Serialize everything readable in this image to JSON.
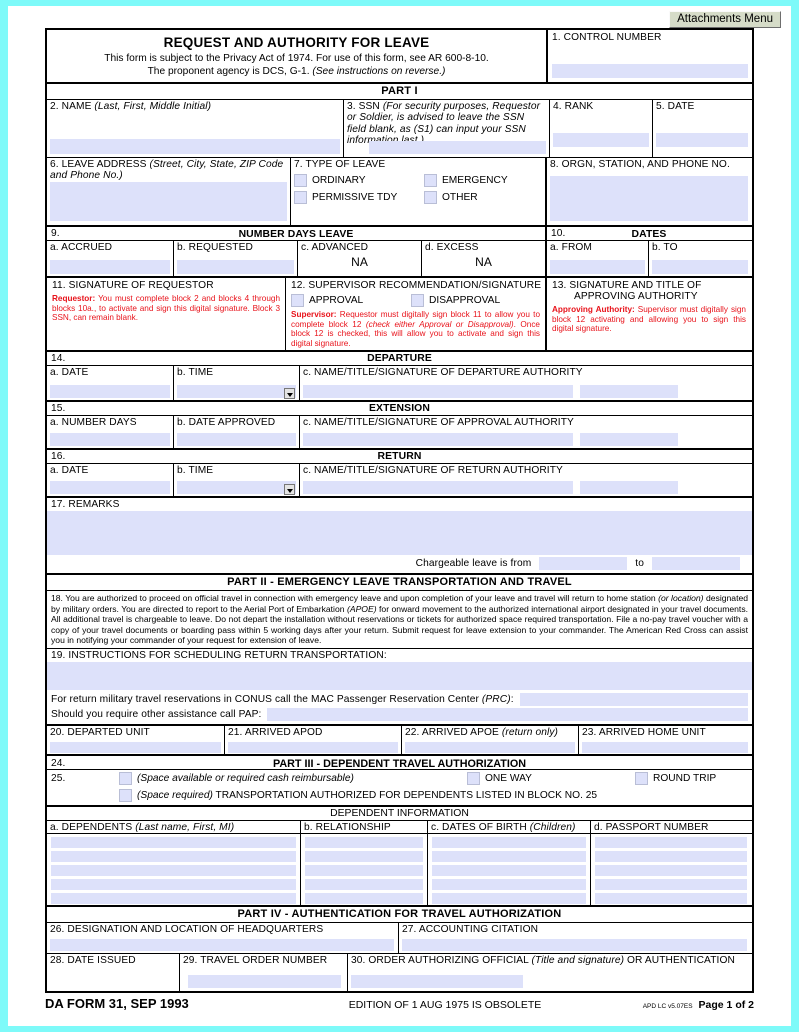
{
  "toolbar": {
    "attachments_label": "Attachments Menu"
  },
  "header": {
    "title": "REQUEST AND AUTHORITY FOR LEAVE",
    "sub1": "This form is subject to the Privacy Act of 1974. For use of this form, see AR 600-8-10.",
    "sub2_a": "The proponent agency is DCS, G-1. ",
    "sub2_b": "(See instructions on reverse.)",
    "block1_label": "1.  CONTROL NUMBER"
  },
  "part1": {
    "bar": "PART I",
    "name_label": "2.  NAME  ",
    "name_hint": "(Last, First, Middle Initial)",
    "ssn_label": "3.  SSN  ",
    "ssn_hint": "(For security purposes, Requestor or Soldier, is advised to leave the SSN field blank, as (S1) can input your SSN information last.)",
    "rank_label": "4.  RANK",
    "date_label": "5.  DATE",
    "address_label": "6.  LEAVE ADDRESS  ",
    "address_hint": "(Street, City, State, ZIP Code and Phone No.)",
    "type_label": "7.  TYPE OF LEAVE",
    "type_options": [
      "ORDINARY",
      "EMERGENCY",
      "PERMISSIVE TDY",
      "OTHER"
    ],
    "orgn_label": "8.  ORGN, STATION, AND PHONE NO.",
    "block9_num": "9.",
    "block9_title": "NUMBER DAYS LEAVE",
    "block10_num": "10.",
    "block10_title": "DATES",
    "days_cols": [
      "a.  ACCRUED",
      "b.  REQUESTED",
      "c.  ADVANCED",
      "d.  EXCESS"
    ],
    "advanced_value": "NA",
    "excess_value": "NA",
    "dates_cols": [
      "a.  FROM",
      "b.  TO"
    ],
    "block11_label": "11.  SIGNATURE OF REQUESTOR",
    "block11_red_bold": "Requestor:",
    "block11_red": " You must complete block 2 and blocks 4 through blocks 10a., to activate and sign this digital signature. Block 3 SSN, can remain blank.",
    "block12_label": "12.  SUPERVISOR RECOMMENDATION/SIGNATURE",
    "block12_options": [
      "APPROVAL",
      "DISAPPROVAL"
    ],
    "block12_red_bold": "Supervisor:",
    "block12_red_a": " Requestor must digitally sign block 11 to allow you to complete block 12 ",
    "block12_red_it": "(check either Approval or Disapproval)",
    "block12_red_b": ". Once block 12 is checked, this will allow you to activate and sign this digital signature.",
    "block13_label_a": "13.  SIGNATURE AND TITLE OF",
    "block13_label_b": "APPROVING AUTHORITY",
    "block13_red_bold": "Approving Authority:",
    "block13_red": " Supervisor must digitally sign block 12 activating and allowing you to sign this digital signature."
  },
  "departure": {
    "num": "14.",
    "title": "DEPARTURE",
    "date_label": "a.  DATE",
    "time_label": "b.  TIME",
    "auth_label": "c.  NAME/TITLE/SIGNATURE OF DEPARTURE AUTHORITY"
  },
  "extension": {
    "num": "15.",
    "title": "EXTENSION",
    "days_label": "a.  NUMBER DAYS",
    "date_label": "b.  DATE APPROVED",
    "auth_label": "c.  NAME/TITLE/SIGNATURE OF APPROVAL AUTHORITY"
  },
  "return": {
    "num": "16.",
    "title": "RETURN",
    "date_label": "a.  DATE",
    "time_label": "b.  TIME",
    "auth_label": "c.  NAME/TITLE/SIGNATURE OF RETURN AUTHORITY"
  },
  "remarks": {
    "label": "17.  REMARKS",
    "chargeable_from": "Chargeable leave is from",
    "chargeable_to": "to"
  },
  "part2": {
    "bar": "PART II - EMERGENCY LEAVE TRANSPORTATION AND TRAVEL",
    "block18_num": "18.",
    "block18_text_1": "You are authorized to proceed on official travel in connection with emergency leave and upon completion of your leave and travel will return to home station ",
    "block18_it_1": "(or location)",
    "block18_text_2": " designated by military orders. You are directed to report to the Aerial Port of Embarkation ",
    "block18_it_2": "(APOE)",
    "block18_text_3": " for onward movement to the authorized international airport designated in your travel documents. All additional travel is chargeable to leave. Do not depart the installation without reservations or tickets for authorized space required transportation. File a no-pay travel voucher with a copy of your travel documents or boarding pass within 5 working days after your return. Submit request for leave extension to your commander. The American Red Cross can assist you in notifying your commander of your request for extension of leave.",
    "block19_label": "19. INSTRUCTIONS FOR SCHEDULING RETURN TRANSPORTATION:",
    "conus_text": "For return military travel reservations in CONUS call the MAC Passenger Reservation Center ",
    "conus_it": "(PRC)",
    "conus_colon": ":",
    "pap_text": "Should you require other assistance call PAP:",
    "block20": "20.  DEPARTED UNIT",
    "block21": "21.  ARRIVED APOD",
    "block22_a": "22.  ARRIVED APOE ",
    "block22_it": "(return only)",
    "block23": "23.  ARRIVED HOME UNIT"
  },
  "part3": {
    "block24_num": "24.",
    "bar": "PART III - DEPENDENT TRAVEL AUTHORIZATION",
    "block25_num": "25.",
    "opt1_it": "(Space available or required cash reimbursable)",
    "opt_one_way": "ONE WAY",
    "opt_round_trip": "ROUND TRIP",
    "opt2_it": "(Space required)",
    "opt2_text": " TRANSPORTATION AUTHORIZED FOR DEPENDENTS LISTED IN BLOCK NO. 25",
    "dep_info_title": "DEPENDENT INFORMATION",
    "col_a_label": "a.  DEPENDENTS  ",
    "col_a_hint": "(Last name, First, MI)",
    "col_b_label": "b.  RELATIONSHIP",
    "col_c_label": "c.  DATES OF BIRTH ",
    "col_c_hint": "(Children)",
    "col_d_label": "d.  PASSPORT NUMBER",
    "row_count": 5
  },
  "part4": {
    "bar": "PART IV - AUTHENTICATION FOR TRAVEL AUTHORIZATION",
    "block26": "26.  DESIGNATION AND LOCATION OF HEADQUARTERS",
    "block27": "27.  ACCOUNTING CITATION",
    "block28": "28.  DATE ISSUED",
    "block29": "29.  TRAVEL ORDER NUMBER",
    "block30_a": "30.  ORDER AUTHORIZING OFFICIAL ",
    "block30_it": "(Title and signature)",
    "block30_b": " OR AUTHENTICATION"
  },
  "footer": {
    "form_id": "DA FORM 31, SEP 1993",
    "edition": "EDITION OF 1 AUG 1975 IS OBSOLETE",
    "apd": "APD LC v5.07ES",
    "page": "Page 1 of 2"
  },
  "colors": {
    "page_background": "#7efaf9",
    "field_fill": "#dde1fa",
    "instruction_red": "#e8131b",
    "button_face": "#d6dcc8"
  }
}
